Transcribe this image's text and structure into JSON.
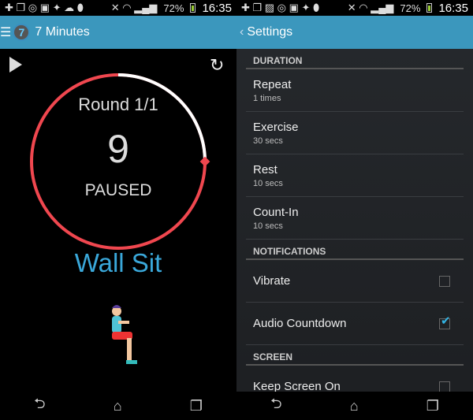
{
  "status_bar": {
    "battery": "72%",
    "time": "16:35"
  },
  "left": {
    "app_title": "7 Minutes",
    "logo_text": "7",
    "round": "Round 1/1",
    "count": "9",
    "state": "PAUSED",
    "exercise": "Wall Sit",
    "progress_fraction": 0.25,
    "colors": {
      "remaining": "#f0474f",
      "elapsed": "#ffffff",
      "exercise": "#3aa8da"
    }
  },
  "right": {
    "title": "Settings",
    "back": "‹",
    "sections": [
      {
        "header": "DURATION",
        "items": [
          {
            "title": "Repeat",
            "summary": "1 times"
          },
          {
            "title": "Exercise",
            "summary": "30 secs"
          },
          {
            "title": "Rest",
            "summary": "10 secs"
          },
          {
            "title": "Count-In",
            "summary": "10 secs"
          }
        ]
      },
      {
        "header": "NOTIFICATIONS",
        "items": [
          {
            "title": "Vibrate",
            "checked": false
          },
          {
            "title": "Audio Countdown",
            "checked": true
          }
        ]
      },
      {
        "header": "SCREEN",
        "items": [
          {
            "title": "Keep Screen On",
            "checked": false
          }
        ]
      }
    ]
  },
  "nav": {
    "back": "⮌",
    "home": "⌂",
    "recents": "❐"
  },
  "accent": "#3b97bd"
}
